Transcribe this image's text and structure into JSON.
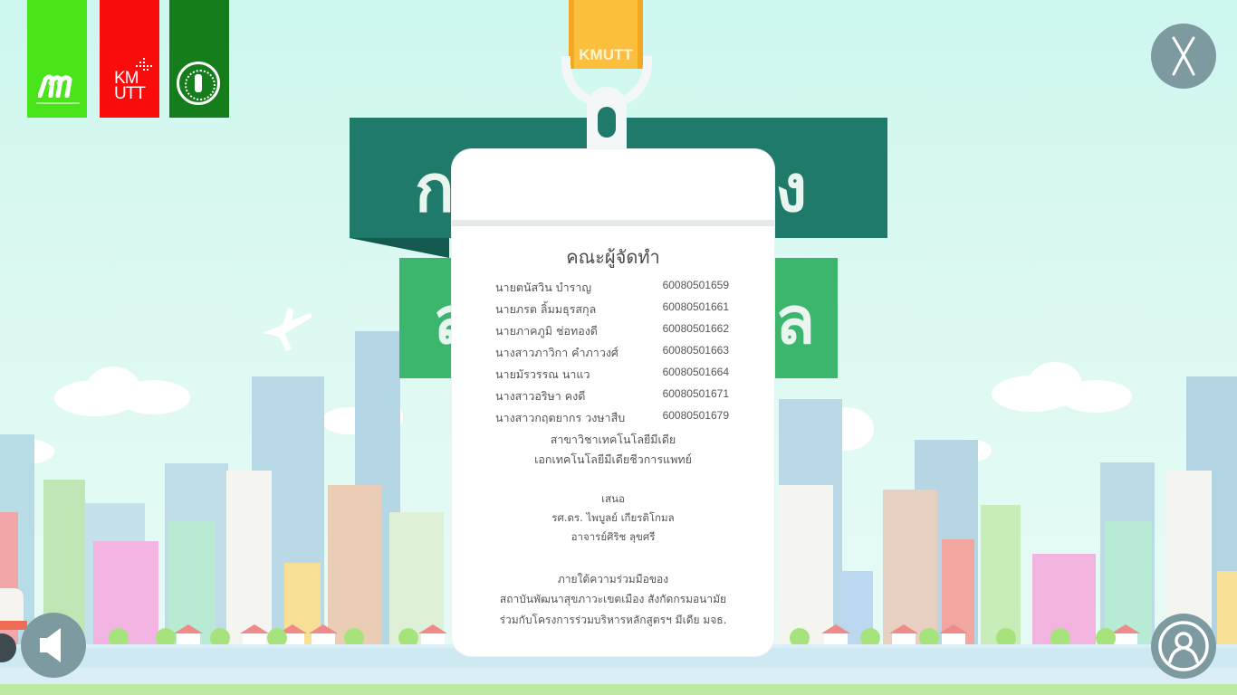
{
  "logos": {
    "first_icon": "m-media-technology-logo",
    "second_text": "KMUTT",
    "third_icon": "ministry-of-public-health-seal"
  },
  "lanyard": {
    "strap_text": "KMUTT"
  },
  "colors": {
    "banner_dark": "#1f7a6a",
    "banner_light": "#3cb56d",
    "button": "#7d9aa0",
    "sky": "#cdf7ef"
  },
  "credits": {
    "title": "คณะผู้จัดทำ",
    "members": [
      {
        "name": "นายตนัสวิน  บำราญ",
        "id": "60080501659"
      },
      {
        "name": "นายภรต  ลิ้มมธุรสกุล",
        "id": "60080501661"
      },
      {
        "name": "นายภาคภูมิ  ช่อทองดี",
        "id": "60080501662"
      },
      {
        "name": "นางสาวภาวิกา  คำภาวงศ์",
        "id": "60080501663"
      },
      {
        "name": "นายมัรวรรณ  นาแว",
        "id": "60080501664"
      },
      {
        "name": "นางสาวอริษา  คงดี",
        "id": "60080501671"
      },
      {
        "name": "นางสาวกฤตยากร  วงษาสืบ",
        "id": "60080501679"
      }
    ],
    "department": "สาขาวิชาเทคโนโลยีมีเดีย",
    "major": "เอกเทคโนโลยีมีเดียชีวการแพทย์",
    "present_label": "เสนอ",
    "advisor1": "รศ.ดร. ไพบูลย์  เกียรติโกมล",
    "advisor2": "อาจารย์ศิริช  ลุขศรี",
    "collab_label": "ภายใต้ความร่วมมือของ",
    "collab1": "สถาบันพัฒนาสุขภาวะเขตเมือง สังกัดกรมอนามัย",
    "collab2": "ร่วมกับโครงการร่วมบริหารหลักสูตรฯ มีเดีย มจธ."
  },
  "buttons": {
    "close_icon": "close-x-icon",
    "sound_icon": "speaker-icon",
    "credits_icon": "user-icon"
  }
}
